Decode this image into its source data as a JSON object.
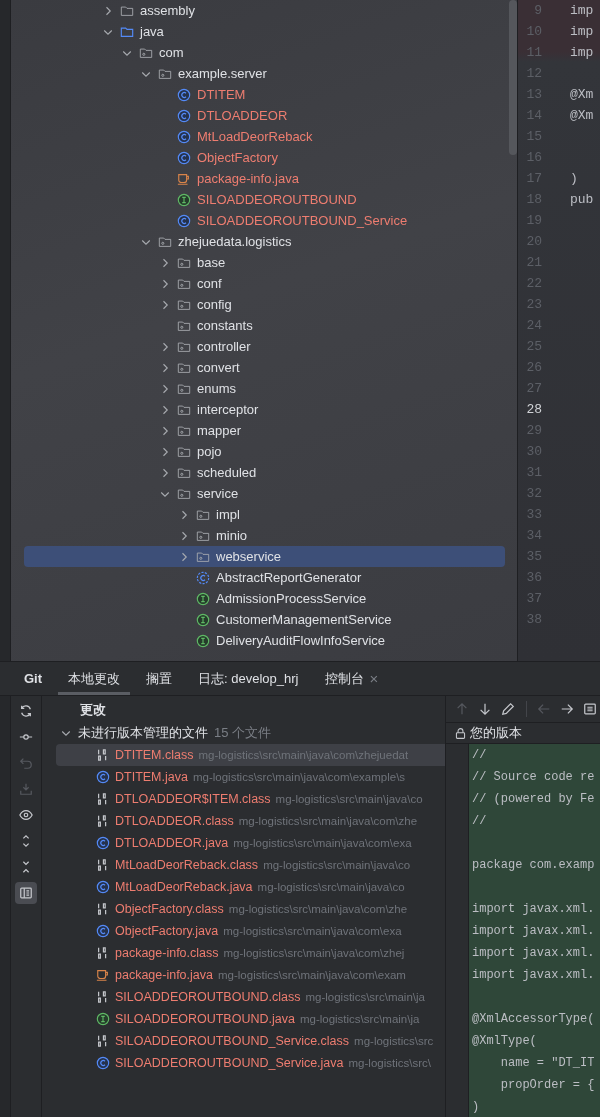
{
  "project_tree": [
    {
      "label": "assembly",
      "kind": "folder",
      "expanded": false,
      "untracked": false,
      "selected": false
    },
    {
      "label": "java",
      "kind": "source_folder",
      "expanded": true,
      "untracked": false,
      "selected": false,
      "children": [
        {
          "label": "com",
          "kind": "package",
          "expanded": true,
          "untracked": false,
          "selected": false,
          "children": [
            {
              "label": "example.server",
              "kind": "package",
              "expanded": true,
              "untracked": false,
              "selected": false,
              "children": [
                {
                  "label": "DTITEM",
                  "kind": "class",
                  "untracked": true,
                  "selected": false
                },
                {
                  "label": "DTLOADDEOR",
                  "kind": "class",
                  "untracked": true,
                  "selected": false
                },
                {
                  "label": "MtLoadDeorReback",
                  "kind": "class",
                  "untracked": true,
                  "selected": false
                },
                {
                  "label": "ObjectFactory",
                  "kind": "class",
                  "untracked": true,
                  "selected": false
                },
                {
                  "label": "package-info.java",
                  "kind": "java_file",
                  "untracked": true,
                  "selected": false
                },
                {
                  "label": "SILOADDEOROUTBOUND",
                  "kind": "interface",
                  "untracked": true,
                  "selected": false
                },
                {
                  "label": "SILOADDEOROUTBOUND_Service",
                  "kind": "class",
                  "untracked": true,
                  "selected": false
                }
              ]
            },
            {
              "label": "zhejuedata.logistics",
              "kind": "package",
              "expanded": true,
              "untracked": false,
              "selected": false,
              "children": [
                {
                  "label": "base",
                  "kind": "package",
                  "expanded": false,
                  "untracked": false,
                  "selected": false
                },
                {
                  "label": "conf",
                  "kind": "package",
                  "expanded": false,
                  "untracked": false,
                  "selected": false
                },
                {
                  "label": "config",
                  "kind": "package",
                  "expanded": false,
                  "untracked": false,
                  "selected": false
                },
                {
                  "label": "constants",
                  "kind": "package",
                  "untracked": false,
                  "selected": false
                },
                {
                  "label": "controller",
                  "kind": "package",
                  "expanded": false,
                  "untracked": false,
                  "selected": false
                },
                {
                  "label": "convert",
                  "kind": "package",
                  "expanded": false,
                  "untracked": false,
                  "selected": false
                },
                {
                  "label": "enums",
                  "kind": "package",
                  "expanded": false,
                  "untracked": false,
                  "selected": false
                },
                {
                  "label": "interceptor",
                  "kind": "package",
                  "expanded": false,
                  "untracked": false,
                  "selected": false
                },
                {
                  "label": "mapper",
                  "kind": "package",
                  "expanded": false,
                  "untracked": false,
                  "selected": false
                },
                {
                  "label": "pojo",
                  "kind": "package",
                  "expanded": false,
                  "untracked": false,
                  "selected": false
                },
                {
                  "label": "scheduled",
                  "kind": "package",
                  "expanded": false,
                  "untracked": false,
                  "selected": false
                },
                {
                  "label": "service",
                  "kind": "package",
                  "expanded": true,
                  "untracked": false,
                  "selected": false,
                  "children": [
                    {
                      "label": "impl",
                      "kind": "package",
                      "expanded": false,
                      "untracked": false,
                      "selected": false
                    },
                    {
                      "label": "minio",
                      "kind": "package",
                      "expanded": false,
                      "untracked": false,
                      "selected": false
                    },
                    {
                      "label": "webservice",
                      "kind": "package",
                      "expanded": false,
                      "untracked": false,
                      "selected": true
                    },
                    {
                      "label": "AbstractReportGenerator",
                      "kind": "abstract_class",
                      "untracked": false,
                      "selected": false
                    },
                    {
                      "label": "AdmissionProcessService",
                      "kind": "interface",
                      "untracked": false,
                      "selected": false
                    },
                    {
                      "label": "CustomerManagementService",
                      "kind": "interface",
                      "untracked": false,
                      "selected": false
                    },
                    {
                      "label": "DeliveryAuditFlowInfoService",
                      "kind": "interface",
                      "untracked": false,
                      "selected": false
                    }
                  ]
                }
              ]
            }
          ]
        }
      ]
    }
  ],
  "editor": {
    "lines": [
      {
        "number": "9",
        "code": "imp",
        "current": false
      },
      {
        "number": "10",
        "code": "imp",
        "current": false
      },
      {
        "number": "11",
        "code": "imp",
        "current": false
      },
      {
        "number": "12",
        "current": false
      },
      {
        "number": "13",
        "code": "@Xm",
        "current": false
      },
      {
        "number": "14",
        "code": "@Xm",
        "current": false
      },
      {
        "number": "15",
        "current": false
      },
      {
        "number": "16",
        "current": false
      },
      {
        "number": "17",
        "code": ")",
        "current": false
      },
      {
        "number": "18",
        "code": "pub",
        "current": false
      },
      {
        "number": "19",
        "current": false
      },
      {
        "number": "20",
        "current": false
      },
      {
        "number": "21",
        "current": false
      },
      {
        "number": "22",
        "current": false
      },
      {
        "number": "23",
        "current": false
      },
      {
        "number": "24",
        "current": false
      },
      {
        "number": "25",
        "current": false
      },
      {
        "number": "26",
        "current": false
      },
      {
        "number": "27",
        "current": false
      },
      {
        "number": "28",
        "current": true
      },
      {
        "number": "29",
        "current": false
      },
      {
        "number": "30",
        "current": false
      },
      {
        "number": "31",
        "current": false
      },
      {
        "number": "32",
        "current": false
      },
      {
        "number": "33",
        "current": false
      },
      {
        "number": "34",
        "current": false
      },
      {
        "number": "35",
        "current": false
      },
      {
        "number": "36",
        "current": false
      },
      {
        "number": "37",
        "current": false
      },
      {
        "number": "38",
        "current": false
      }
    ]
  },
  "git_panel": {
    "title": "Git",
    "tabs": [
      {
        "label": "本地更改",
        "selected": true
      },
      {
        "label": "搁置",
        "selected": false
      },
      {
        "label": "日志: develop_hrj",
        "selected": false
      },
      {
        "label": "控制台",
        "selected": false,
        "close": "×"
      }
    ],
    "tools": [
      {
        "kind": "refresh",
        "disabled": false,
        "active": false
      },
      {
        "kind": "commit",
        "disabled": false,
        "active": false
      },
      {
        "kind": "undo",
        "disabled": true,
        "active": false
      },
      {
        "kind": "download",
        "disabled": true,
        "active": false
      },
      {
        "kind": "eye",
        "disabled": false,
        "active": false
      },
      {
        "kind": "expand",
        "disabled": false,
        "active": false
      },
      {
        "kind": "collapse",
        "disabled": false,
        "active": false
      },
      {
        "kind": "preview",
        "disabled": false,
        "active": true
      }
    ],
    "changes_heading": "更改",
    "group": {
      "label": "未进行版本管理的文件",
      "count": "15 个文件",
      "expanded": true
    },
    "files": [
      {
        "name": "DTITEM.class",
        "path": "mg-logistics\\src\\main\\java\\com\\zhejuedat",
        "kind": "binary",
        "selected": true
      },
      {
        "name": "DTITEM.java",
        "path": "mg-logistics\\src\\main\\java\\com\\example\\s",
        "kind": "class",
        "selected": false
      },
      {
        "name": "DTLOADDEOR$ITEM.class",
        "path": "mg-logistics\\src\\main\\java\\co",
        "kind": "binary",
        "selected": false
      },
      {
        "name": "DTLOADDEOR.class",
        "path": "mg-logistics\\src\\main\\java\\com\\zhe",
        "kind": "binary",
        "selected": false
      },
      {
        "name": "DTLOADDEOR.java",
        "path": "mg-logistics\\src\\main\\java\\com\\exa",
        "kind": "class",
        "selected": false
      },
      {
        "name": "MtLoadDeorReback.class",
        "path": "mg-logistics\\src\\main\\java\\co",
        "kind": "binary",
        "selected": false
      },
      {
        "name": "MtLoadDeorReback.java",
        "path": "mg-logistics\\src\\main\\java\\co",
        "kind": "class",
        "selected": false
      },
      {
        "name": "ObjectFactory.class",
        "path": "mg-logistics\\src\\main\\java\\com\\zhe",
        "kind": "binary",
        "selected": false
      },
      {
        "name": "ObjectFactory.java",
        "path": "mg-logistics\\src\\main\\java\\com\\exa",
        "kind": "class",
        "selected": false
      },
      {
        "name": "package-info.class",
        "path": "mg-logistics\\src\\main\\java\\com\\zhej",
        "kind": "binary",
        "selected": false
      },
      {
        "name": "package-info.java",
        "path": "mg-logistics\\src\\main\\java\\com\\exam",
        "kind": "java_file",
        "selected": false
      },
      {
        "name": "SILOADDEOROUTBOUND.class",
        "path": "mg-logistics\\src\\main\\ja",
        "kind": "binary",
        "selected": false
      },
      {
        "name": "SILOADDEOROUTBOUND.java",
        "path": "mg-logistics\\src\\main\\ja",
        "kind": "interface",
        "selected": false
      },
      {
        "name": "SILOADDEOROUTBOUND_Service.class",
        "path": "mg-logistics\\src",
        "kind": "binary",
        "selected": false
      },
      {
        "name": "SILOADDEOROUTBOUND_Service.java",
        "path": "mg-logistics\\src\\",
        "kind": "class",
        "selected": false
      }
    ],
    "diff": {
      "tools": [
        {
          "kind": "up",
          "disabled": true
        },
        {
          "kind": "down",
          "disabled": false
        },
        {
          "kind": "edit",
          "disabled": false
        },
        {
          "kind": "back",
          "disabled": true
        },
        {
          "kind": "forward",
          "disabled": false
        },
        {
          "kind": "menu",
          "disabled": false
        }
      ],
      "header": "您的版本",
      "lines": [
        {
          "kind": "code",
          "text": "//"
        },
        {
          "kind": "code",
          "text": "// Source code re"
        },
        {
          "kind": "code",
          "text": "// (powered by Fe"
        },
        {
          "kind": "code",
          "text": "//"
        },
        {
          "kind": "blank"
        },
        {
          "kind": "code",
          "text": "package com.examp"
        },
        {
          "kind": "blank"
        },
        {
          "kind": "code",
          "text": "import javax.xml."
        },
        {
          "kind": "code",
          "text": "import javax.xml."
        },
        {
          "kind": "code",
          "text": "import javax.xml."
        },
        {
          "kind": "code",
          "text": "import javax.xml."
        },
        {
          "kind": "blank"
        },
        {
          "kind": "code",
          "text": "@XmlAccessorType("
        },
        {
          "kind": "code",
          "text": "@XmlType("
        },
        {
          "kind": "code",
          "text": "    name = \"DT_IT"
        },
        {
          "kind": "code",
          "text": "    propOrder = {"
        },
        {
          "kind": "code",
          "text": ")"
        }
      ]
    }
  }
}
